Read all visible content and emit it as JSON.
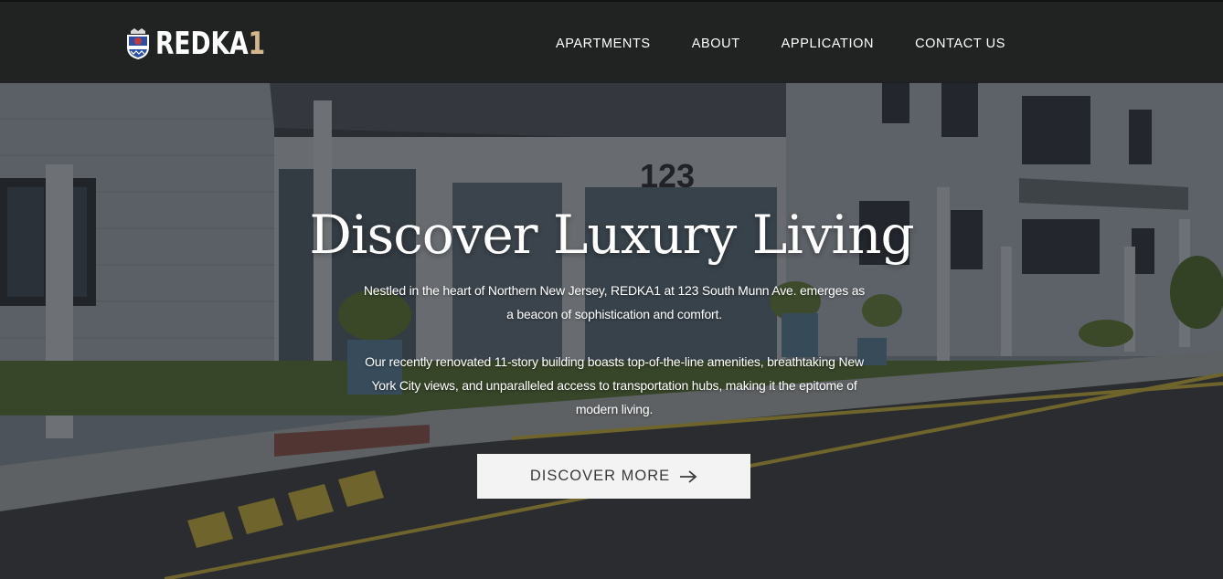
{
  "brand": {
    "name_main": "REDKA",
    "name_accent": "1",
    "accent_color": "#d3b88c",
    "crest_icon": "crest-icon"
  },
  "nav": {
    "items": [
      {
        "label": "APARTMENTS"
      },
      {
        "label": "ABOUT"
      },
      {
        "label": "APPLICATION"
      },
      {
        "label": "CONTACT US"
      }
    ]
  },
  "hero": {
    "title": "Discover Luxury Living",
    "paragraph_1": "Nestled in the heart of Northern New Jersey, REDKA1 at 123 South Munn Ave. emerges as a beacon of sophistication and comfort.",
    "paragraph_2": "Our recently renovated 11-story building boasts top-of-the-line amenities, breathtaking New York City views, and unparalleled access to transportation hubs, making it the epitome of modern living.",
    "cta_label": "DISCOVER MORE",
    "cta_icon": "arrow-right-icon",
    "background_image": "building-photo"
  }
}
